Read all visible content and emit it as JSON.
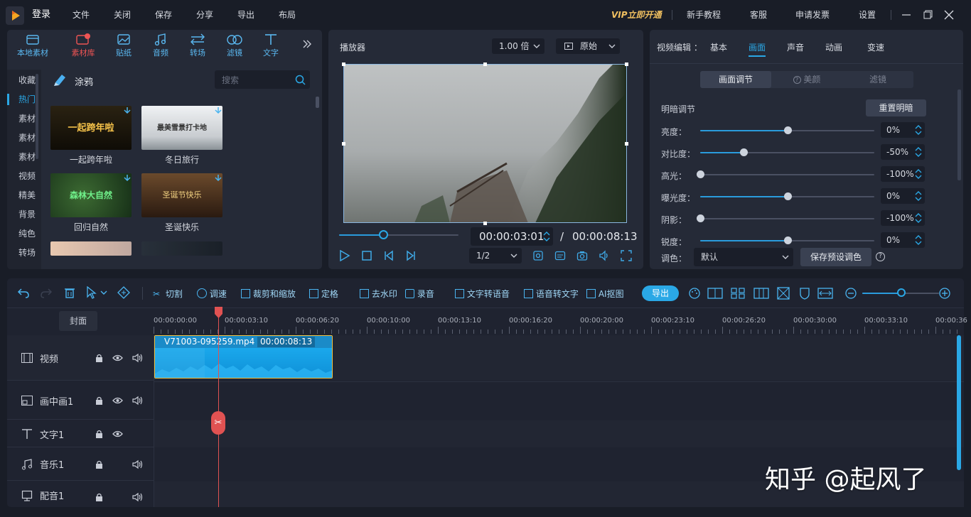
{
  "topbar": {
    "login": "登录",
    "menu": [
      "文件",
      "关闭",
      "保存",
      "分享",
      "导出",
      "布局"
    ],
    "vip": "VIP立即开通",
    "right_menu": [
      "新手教程",
      "客服",
      "申请发票",
      "设置"
    ]
  },
  "assets": {
    "tabs": [
      {
        "label": "本地素材",
        "icon": "box-icon"
      },
      {
        "label": "素材库",
        "icon": "media-library-icon"
      },
      {
        "label": "贴纸",
        "icon": "sticker-icon"
      },
      {
        "label": "音频",
        "icon": "music-icon"
      },
      {
        "label": "转场",
        "icon": "transition-icon"
      },
      {
        "label": "滤镜",
        "icon": "filter-icon"
      },
      {
        "label": "文字",
        "icon": "text-icon"
      }
    ],
    "sidebar": [
      "收藏",
      "热门",
      "素材",
      "素材",
      "素材",
      "视频",
      "精美",
      "背景",
      "纯色",
      "转场"
    ],
    "category": "涂鸦",
    "search_placeholder": "搜索",
    "items": [
      {
        "label": "一起跨年啦",
        "overlay": "一起跨年啦",
        "color": "#1a1509"
      },
      {
        "label": "冬日旅行",
        "overlay": "最美雪景打卡地",
        "color": "#e3e6ea"
      },
      {
        "label": "回归自然",
        "overlay": "森林大自然",
        "color": "#1f3a1f"
      },
      {
        "label": "圣诞快乐",
        "overlay": "圣诞节快乐",
        "color": "#4a3220"
      }
    ]
  },
  "player": {
    "title": "播放器",
    "speed": "1.00 倍",
    "ratio": "原始",
    "current_time": "00:00:03:01",
    "separator": "/",
    "total_time": "00:00:08:13",
    "quality": "1/2",
    "progress": 0.37
  },
  "props": {
    "prefix": "视频编辑 ：",
    "tabs": [
      "基本",
      "画面",
      "声音",
      "动画",
      "变速"
    ],
    "active_tab": "画面",
    "subtabs": [
      "画面调节",
      "美颜",
      "滤镜"
    ],
    "section": "明暗调节",
    "reset": "重置明暗",
    "sliders": [
      {
        "label": "亮度：",
        "value": "0%",
        "pos": 0.5
      },
      {
        "label": "对比度：",
        "value": "-50%",
        "pos": 0.25
      },
      {
        "label": "高光：",
        "value": "-100%",
        "pos": 0.0
      },
      {
        "label": "曝光度：",
        "value": "0%",
        "pos": 0.5
      },
      {
        "label": "阴影：",
        "value": "-100%",
        "pos": 0.0
      },
      {
        "label": "锐度：",
        "value": "0%",
        "pos": 0.5
      }
    ],
    "tone_label": "调色：",
    "tone_value": "默认",
    "save_preset": "保存预设调色"
  },
  "toolbar": {
    "tools": [
      "切割",
      "调速",
      "裁剪和缩放",
      "定格",
      "去水印",
      "录音",
      "文字转语音",
      "语音转文字",
      "AI抠图"
    ],
    "export": "导出"
  },
  "timeline": {
    "cover": "封面",
    "ruler": [
      "00:00:00:00",
      "00:00:03:10",
      "00:00:06:20",
      "00:00:10:00",
      "00:00:13:10",
      "00:00:16:20",
      "00:00:20:00",
      "00:00:23:10",
      "00:00:26:20",
      "00:00:30:00",
      "00:00:33:10",
      "00:00:36"
    ],
    "tracks": [
      "视频",
      "画中画1",
      "文字1",
      "音乐1",
      "配音1"
    ],
    "clip_name": "V71003-095259.mp4",
    "clip_duration": "00:00:08:13"
  },
  "watermark": "知乎 @起风了",
  "colors": {
    "accent": "#2aa8e6",
    "playhead": "#e05252",
    "bg": "#191d27",
    "panel": "#252a37"
  }
}
